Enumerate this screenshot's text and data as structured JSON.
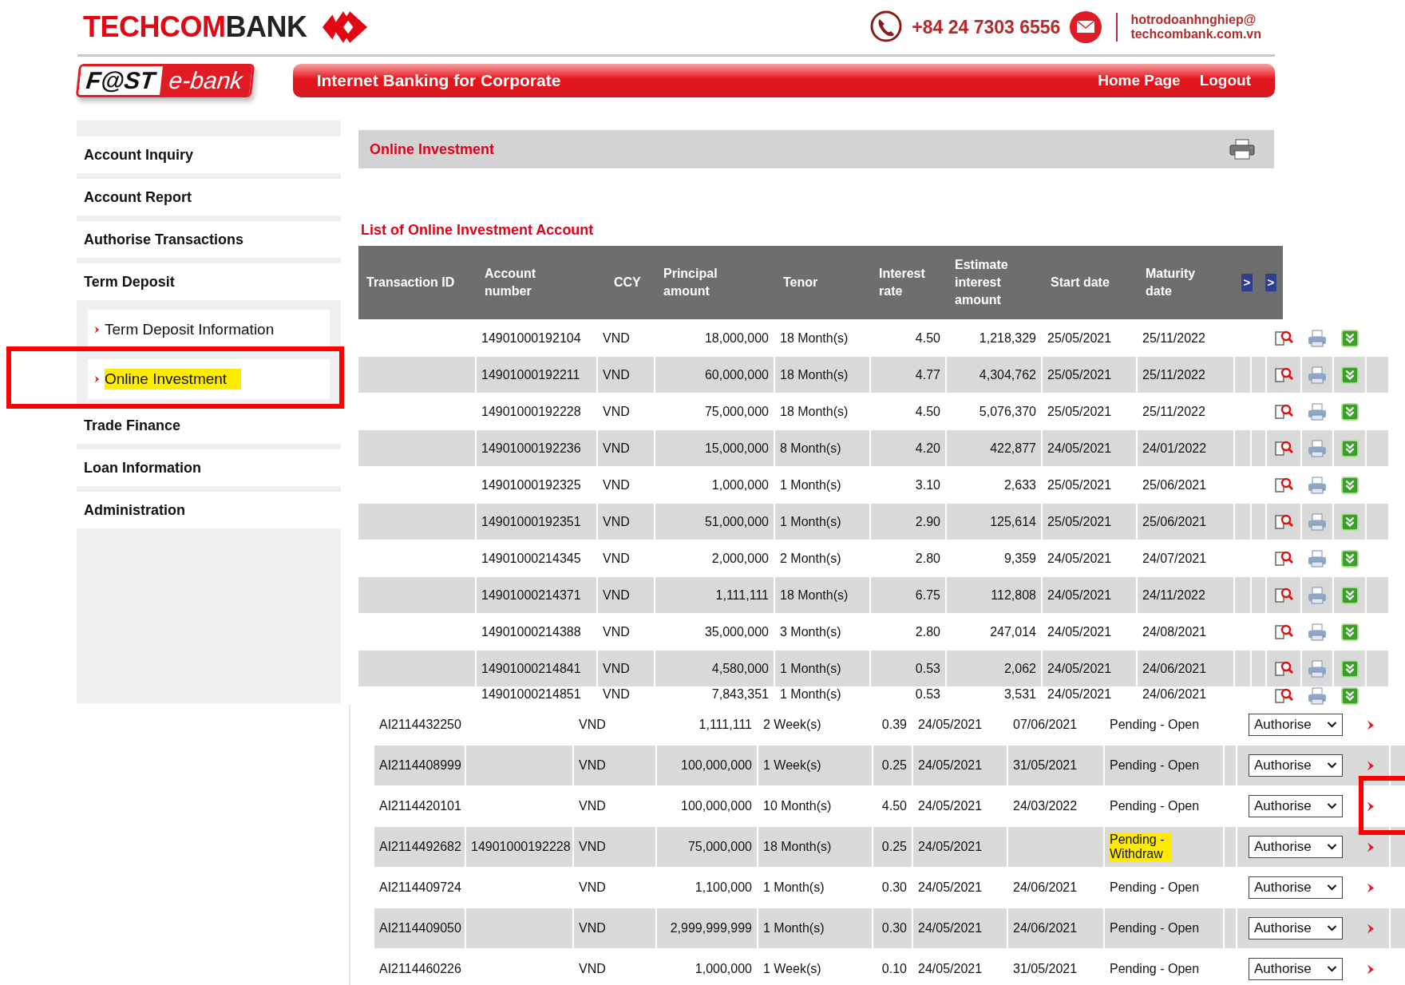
{
  "brand": {
    "parts": [
      "TECHCOM",
      "BANK"
    ],
    "phone": "+84 24 7303 6556",
    "email_lines": [
      "hotrodoanhnghiep@",
      "techcombank.com.vn"
    ]
  },
  "logo": {
    "left": "F@ST",
    "right": "e-bank"
  },
  "banner": {
    "title": "Internet Banking for Corporate",
    "links": [
      "Home Page",
      "Logout"
    ]
  },
  "sidebar": {
    "items": [
      {
        "label": "Account Inquiry"
      },
      {
        "label": "Account Report"
      },
      {
        "label": "Authorise Transactions"
      },
      {
        "label": "Term Deposit",
        "children": [
          {
            "label": "Term Deposit Information",
            "highlighted": false
          },
          {
            "label": "Online Investment",
            "highlighted": true
          }
        ]
      },
      {
        "label": "Trade Finance"
      },
      {
        "label": "Loan Information"
      },
      {
        "label": "Administration"
      }
    ]
  },
  "page_title": "Online Investment",
  "accounts": {
    "title": "List of Online Investment Account",
    "columns": [
      "Transaction ID",
      "Account number",
      "CCY",
      "Principal amount",
      "Tenor",
      "Interest rate",
      "Estimate interest amount",
      "Start date",
      "Maturity date"
    ],
    "nav_buttons": [
      ">",
      ">"
    ],
    "rows": [
      {
        "account": "14901000192104",
        "ccy": "VND",
        "principal": "18,000,000",
        "tenor": "18 Month(s)",
        "rate": "4.50",
        "estimate": "1,218,329",
        "start": "25/05/2021",
        "maturity": "25/11/2022"
      },
      {
        "account": "14901000192211",
        "ccy": "VND",
        "principal": "60,000,000",
        "tenor": "18 Month(s)",
        "rate": "4.77",
        "estimate": "4,304,762",
        "start": "25/05/2021",
        "maturity": "25/11/2022"
      },
      {
        "account": "14901000192228",
        "ccy": "VND",
        "principal": "75,000,000",
        "tenor": "18 Month(s)",
        "rate": "4.50",
        "estimate": "5,076,370",
        "start": "25/05/2021",
        "maturity": "25/11/2022"
      },
      {
        "account": "14901000192236",
        "ccy": "VND",
        "principal": "15,000,000",
        "tenor": "8 Month(s)",
        "rate": "4.20",
        "estimate": "422,877",
        "start": "24/05/2021",
        "maturity": "24/01/2022"
      },
      {
        "account": "14901000192325",
        "ccy": "VND",
        "principal": "1,000,000",
        "tenor": "1 Month(s)",
        "rate": "3.10",
        "estimate": "2,633",
        "start": "25/05/2021",
        "maturity": "25/06/2021"
      },
      {
        "account": "14901000192351",
        "ccy": "VND",
        "principal": "51,000,000",
        "tenor": "1 Month(s)",
        "rate": "2.90",
        "estimate": "125,614",
        "start": "25/05/2021",
        "maturity": "25/06/2021"
      },
      {
        "account": "14901000214345",
        "ccy": "VND",
        "principal": "2,000,000",
        "tenor": "2 Month(s)",
        "rate": "2.80",
        "estimate": "9,359",
        "start": "24/05/2021",
        "maturity": "24/07/2021"
      },
      {
        "account": "14901000214371",
        "ccy": "VND",
        "principal": "1,111,111",
        "tenor": "18 Month(s)",
        "rate": "6.75",
        "estimate": "112,808",
        "start": "24/05/2021",
        "maturity": "24/11/2022"
      },
      {
        "account": "14901000214388",
        "ccy": "VND",
        "principal": "35,000,000",
        "tenor": "3 Month(s)",
        "rate": "2.80",
        "estimate": "247,014",
        "start": "24/05/2021",
        "maturity": "24/08/2021"
      },
      {
        "account": "14901000214841",
        "ccy": "VND",
        "principal": "4,580,000",
        "tenor": "1 Month(s)",
        "rate": "0.53",
        "estimate": "2,062",
        "start": "24/05/2021",
        "maturity": "24/06/2021"
      },
      {
        "account": "14901000214851",
        "ccy": "VND",
        "principal": "7,843,351",
        "tenor": "1 Month(s)",
        "rate": "0.53",
        "estimate": "3,531",
        "start": "24/05/2021",
        "maturity": "24/06/2021"
      }
    ]
  },
  "transactions": {
    "rows": [
      {
        "id": "AI2114432250",
        "ccy": "VND",
        "principal": "1,111,111",
        "tenor": "2 Week(s)",
        "rate": "0.39",
        "start": "24/05/2021",
        "maturity": "07/06/2021",
        "status": "Pending - Open",
        "highlighted": false,
        "action": "Authorise"
      },
      {
        "id": "AI2114408999",
        "ccy": "VND",
        "principal": "100,000,000",
        "tenor": "1 Week(s)",
        "rate": "0.25",
        "start": "24/05/2021",
        "maturity": "31/05/2021",
        "status": "Pending - Open",
        "highlighted": false,
        "action": "Authorise"
      },
      {
        "id": "AI2114420101",
        "ccy": "VND",
        "principal": "100,000,000",
        "tenor": "10 Month(s)",
        "rate": "4.50",
        "start": "24/05/2021",
        "maturity": "24/03/2022",
        "status": "Pending - Open",
        "highlighted": false,
        "action": "Authorise"
      },
      {
        "id": "AI2114492682",
        "account": "14901000192228",
        "ccy": "VND",
        "principal": "75,000,000",
        "tenor": "18 Month(s)",
        "rate": "0.25",
        "start": "24/05/2021",
        "status": "Pending - Withdraw",
        "highlighted": true,
        "action": "Authorise"
      },
      {
        "id": "AI2114409724",
        "ccy": "VND",
        "principal": "1,100,000",
        "tenor": "1 Month(s)",
        "rate": "0.30",
        "start": "24/05/2021",
        "maturity": "24/06/2021",
        "status": "Pending - Open",
        "highlighted": false,
        "action": "Authorise"
      },
      {
        "id": "AI2114409050",
        "ccy": "VND",
        "principal": "2,999,999,999",
        "tenor": "1 Month(s)",
        "rate": "0.30",
        "start": "24/05/2021",
        "maturity": "24/06/2021",
        "status": "Pending - Open",
        "highlighted": false,
        "action": "Authorise"
      },
      {
        "id": "AI2114460226",
        "ccy": "VND",
        "principal": "1,000,000",
        "tenor": "1 Week(s)",
        "rate": "0.10",
        "start": "24/05/2021",
        "maturity": "31/05/2021",
        "status": "Pending - Open",
        "highlighted": false,
        "action": "Authorise"
      }
    ]
  }
}
